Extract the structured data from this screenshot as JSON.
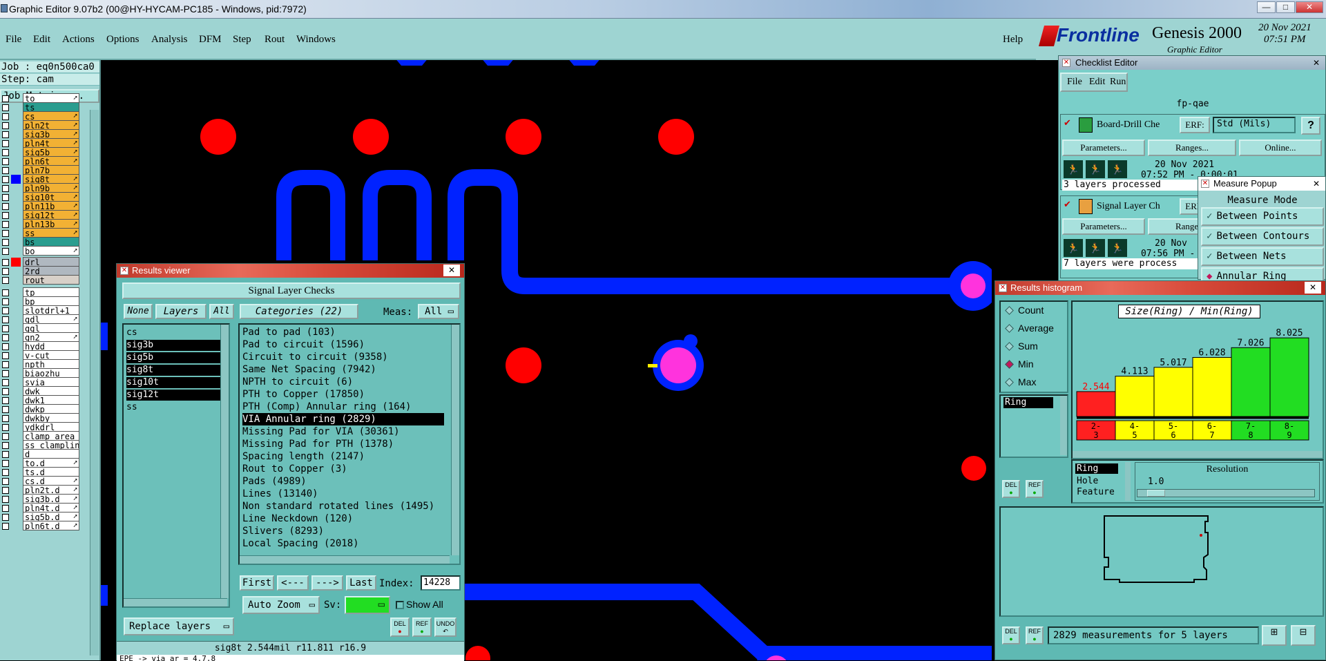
{
  "window": {
    "title": "Graphic Editor 9.07b2 (00@HY-HYCAM-PC185 - Windows, pid:7972)",
    "min": "—",
    "max": "□",
    "close": "✕"
  },
  "menu": {
    "items": [
      "File",
      "Edit",
      "Actions",
      "Options",
      "Analysis",
      "DFM",
      "Step",
      "Rout",
      "Windows"
    ],
    "help": "Help"
  },
  "brand": {
    "logo": "Frontline",
    "product": "Genesis 2000",
    "subtitle": "Graphic Editor",
    "date": "20 Nov 2021",
    "time": "07:51 PM"
  },
  "job": {
    "job": "Job : eq0n500ca0",
    "step": "Step: cam",
    "matrix": "Job Matrix ..."
  },
  "layers": [
    {
      "name": "to",
      "color": "#ffffff",
      "bg": "#ffffff",
      "arrow": true
    },
    {
      "name": "ts",
      "color": "#2a9d8f",
      "bg": "#2a9d8f",
      "arrow": false
    },
    {
      "name": "cs",
      "color": "#f2b134",
      "bg": "#f2b134",
      "arrow": true
    },
    {
      "name": "pln2t",
      "color": "#f2b134",
      "bg": "#f2b134",
      "arrow": true
    },
    {
      "name": "sig3b",
      "color": "#f2b134",
      "bg": "#f2b134",
      "arrow": true
    },
    {
      "name": "pln4t",
      "color": "#f2b134",
      "bg": "#f2b134",
      "arrow": true
    },
    {
      "name": "sig5b",
      "color": "#f2b134",
      "bg": "#f2b134",
      "arrow": true
    },
    {
      "name": "pln6t",
      "color": "#f2b134",
      "bg": "#f2b134",
      "arrow": true
    },
    {
      "name": "pln7b",
      "color": "#f2b134",
      "bg": "#f2b134",
      "arrow": false
    },
    {
      "name": "sig8t",
      "color": "#0000ff",
      "bg": "#f2b134",
      "arrow": true
    },
    {
      "name": "pln9b",
      "color": "#f2b134",
      "bg": "#f2b134",
      "arrow": true
    },
    {
      "name": "sig10t",
      "color": "#f2b134",
      "bg": "#f2b134",
      "arrow": true
    },
    {
      "name": "pln11b",
      "color": "#f2b134",
      "bg": "#f2b134",
      "arrow": true
    },
    {
      "name": "sig12t",
      "color": "#f2b134",
      "bg": "#f2b134",
      "arrow": true
    },
    {
      "name": "pln13b",
      "color": "#f2b134",
      "bg": "#f2b134",
      "arrow": true
    },
    {
      "name": "ss",
      "color": "#f2b134",
      "bg": "#f2b134",
      "arrow": true
    },
    {
      "name": "bs",
      "color": "#2a9d8f",
      "bg": "#2a9d8f",
      "arrow": false
    },
    {
      "name": "bo",
      "color": "#ffffff",
      "bg": "#ffffff",
      "arrow": true
    }
  ],
  "drill_layers": [
    {
      "name": "drl",
      "color": "#ff0000",
      "bg": "#b0b8c0"
    },
    {
      "name": "2rd",
      "color": "#9ed4d2",
      "bg": "#b0b8c0"
    },
    {
      "name": "rout",
      "color": "#9ed4d2",
      "bg": "#d8d0c8"
    }
  ],
  "misc_layers": [
    "tp",
    "bp",
    "slotdrl+1",
    "gdl",
    "ggl",
    "gn2",
    "hydd",
    "v-cut",
    "npth",
    "biaozhu",
    "svia",
    "dwk",
    "dwk1",
    "dwkp",
    "dwkby",
    "ydkdrl",
    "clamp_area",
    "ss_clamplin",
    "d",
    "to.d",
    "ts.d",
    "cs.d",
    "pln2t.d",
    "sig3b.d",
    "pln4t.d",
    "sig5b.d",
    "pln6t.d"
  ],
  "results_viewer": {
    "title": "Results viewer",
    "header": "Signal Layer Checks",
    "none": "None",
    "layers": "Layers",
    "all": "All",
    "categories_label": "Categories (22)",
    "meas_label": "Meas:",
    "meas_value": "All",
    "layer_list": [
      {
        "name": "cs",
        "selected": false
      },
      {
        "name": "sig3b",
        "selected": true
      },
      {
        "name": "sig5b",
        "selected": true
      },
      {
        "name": "sig8t",
        "selected": true
      },
      {
        "name": "sig10t",
        "selected": true
      },
      {
        "name": "sig12t",
        "selected": true
      },
      {
        "name": "ss",
        "selected": false
      }
    ],
    "categories": [
      {
        "name": "Pad to pad (103)",
        "selected": false
      },
      {
        "name": "Pad to circuit (1596)",
        "selected": false
      },
      {
        "name": "Circuit to circuit (9358)",
        "selected": false
      },
      {
        "name": "Same Net Spacing (7942)",
        "selected": false
      },
      {
        "name": "NPTH to circuit (6)",
        "selected": false
      },
      {
        "name": "PTH to Copper (17850)",
        "selected": false
      },
      {
        "name": "PTH (Comp) Annular ring (164)",
        "selected": false
      },
      {
        "name": "VIA Annular ring (2829)",
        "selected": true
      },
      {
        "name": "Missing Pad for VIA (30361)",
        "selected": false
      },
      {
        "name": "Missing Pad for PTH (1378)",
        "selected": false
      },
      {
        "name": "Spacing length (2147)",
        "selected": false
      },
      {
        "name": "Rout to Copper (3)",
        "selected": false
      },
      {
        "name": "Pads (4989)",
        "selected": false
      },
      {
        "name": "Lines (13140)",
        "selected": false
      },
      {
        "name": "Non standard rotated lines (1495)",
        "selected": false
      },
      {
        "name": "Line Neckdown (120)",
        "selected": false
      },
      {
        "name": "Slivers (8293)",
        "selected": false
      },
      {
        "name": "Local Spacing (2018)",
        "selected": false
      }
    ],
    "first": "First",
    "prev": "<---",
    "next": "--->",
    "last": "Last",
    "index_label": "Index:",
    "index_value": "14228",
    "auto_zoom": "Auto Zoom",
    "sv_label": "Sv:",
    "show_all": "Show All",
    "replace_layers": "Replace layers",
    "del": "DEL",
    "ref": "REF",
    "undo": "UNDO",
    "status": "sig8t 2.544mil  r11.811  r16.9",
    "footer": "EPE -> via ar = 4.7.8"
  },
  "checklist": {
    "title": "Checklist Editor",
    "menu": [
      "File",
      "Edit",
      "Run"
    ],
    "name": "fp-qae",
    "items": [
      {
        "name": "Board-Drill Che",
        "erf": "ERF:",
        "erf_value": "Std (Mils)",
        "help": "?",
        "params": "Parameters...",
        "ranges": "Ranges...",
        "online": "Online...",
        "date": "20 Nov 2021",
        "time": "07:52 PM - 0:00:01",
        "status": "3 layers processed"
      },
      {
        "name": "Signal Layer Ch",
        "erf": "ERF:",
        "params": "Parameters...",
        "ranges": "Ranges...",
        "date": "20 Nov",
        "time": "07:56 PM -",
        "status": "7 layers were process"
      }
    ]
  },
  "measure": {
    "title": "Measure Popup",
    "mode": "Measure Mode",
    "options": [
      {
        "label": "Between Points",
        "on": false
      },
      {
        "label": "Between Contours",
        "on": false
      },
      {
        "label": "Between Nets",
        "on": false
      },
      {
        "label": "Annular Ring",
        "on": true
      }
    ]
  },
  "histogram": {
    "title": "Results histogram",
    "chart_title": "Size(Ring) / Min(Ring)",
    "stats": [
      {
        "label": "Count",
        "on": false
      },
      {
        "label": "Average",
        "on": false
      },
      {
        "label": "Sum",
        "on": false
      },
      {
        "label": "Min",
        "on": true
      },
      {
        "label": "Max",
        "on": false
      }
    ],
    "field_list": [
      "Ring"
    ],
    "props": [
      "Ring",
      "Hole",
      "Feature"
    ],
    "resolution_label": "Resolution",
    "resolution_value": "1.0",
    "measurements": "2829 measurements for 5 layers",
    "del": "DEL",
    "ref": "REF"
  },
  "chart_data": {
    "type": "bar",
    "title": "Size(Ring) / Min(Ring)",
    "categories": [
      "2-3",
      "4-5",
      "5-6",
      "6-7",
      "7-8",
      "8-9"
    ],
    "values": [
      2.544,
      4.113,
      5.017,
      6.028,
      7.026,
      8.025
    ],
    "colors": [
      "#ff2020",
      "#ffff00",
      "#ffff00",
      "#ffff00",
      "#22dd22",
      "#22dd22"
    ],
    "value_colors": [
      "#ff0000",
      "#000000",
      "#000000",
      "#000000",
      "#000000",
      "#000000"
    ],
    "ylim": [
      0,
      8.6
    ],
    "grid": false
  }
}
